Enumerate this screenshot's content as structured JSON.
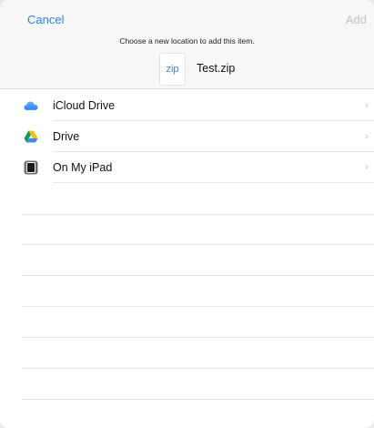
{
  "header": {
    "cancel_label": "Cancel",
    "add_label": "Add",
    "prompt": "Choose a new location to add this item.",
    "file": {
      "icon_text": "zip",
      "name": "Test.zip"
    }
  },
  "locations": [
    {
      "label": "iCloud Drive",
      "icon": "icloud-icon"
    },
    {
      "label": "Drive",
      "icon": "google-drive-icon"
    },
    {
      "label": "On My iPad",
      "icon": "ipad-icon"
    }
  ],
  "colors": {
    "accent": "#2f80f7",
    "disabled": "#c4c4c8",
    "separator": "#e5e5ea"
  }
}
